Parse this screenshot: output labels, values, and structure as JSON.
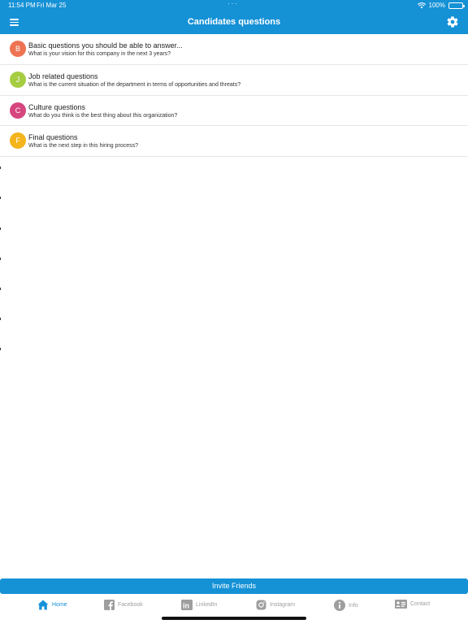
{
  "status_bar": {
    "time": "11:54 PM",
    "date": "Fri Mar 25",
    "battery": "100%"
  },
  "nav": {
    "title": "Candidates questions",
    "menu_icon": "hamburger-menu-icon",
    "settings_icon": "gear-icon"
  },
  "questions": [
    {
      "letter": "B",
      "color": "#ee7352",
      "title": "Basic questions you should be able to answer...",
      "subtitle": "What is your vision for this company in the next 3 years?"
    },
    {
      "letter": "J",
      "color": "#a6cc42",
      "title": "Job related questions",
      "subtitle": "What is the current situation of the department in terms of opportunities and threats?"
    },
    {
      "letter": "C",
      "color": "#d6467f",
      "title": "Culture questions",
      "subtitle": "What do you think is the best thing about this organization?"
    },
    {
      "letter": "F",
      "color": "#f3b41c",
      "title": "Final questions",
      "subtitle": "What is the next step in this hiring process?"
    }
  ],
  "invite_button": "Invite Friends",
  "tabs": {
    "home": "Home",
    "facebook": "Facebook",
    "linkedin": "LinkedIn",
    "instagram": "Instagram",
    "info": "Info",
    "contact": "Contact"
  },
  "colors": {
    "primary": "#1591d6",
    "inactive": "#9e9e9e"
  }
}
